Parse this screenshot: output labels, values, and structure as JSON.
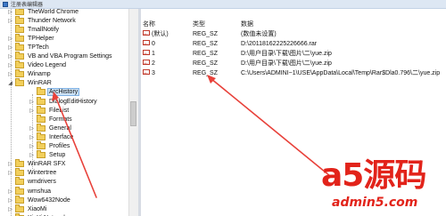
{
  "window": {
    "title": "注册表编辑器"
  },
  "tree": {
    "items": [
      {
        "label": "TheWorld Chrome",
        "depth": 0,
        "expander": "▷"
      },
      {
        "label": "Thunder Network",
        "depth": 0,
        "expander": "▷"
      },
      {
        "label": "TmallNotify",
        "depth": 0,
        "expander": ""
      },
      {
        "label": "TPHelper",
        "depth": 0,
        "expander": "▷"
      },
      {
        "label": "TPTech",
        "depth": 0,
        "expander": "▷"
      },
      {
        "label": "VB and VBA Program Settings",
        "depth": 0,
        "expander": "▷"
      },
      {
        "label": "Video Legend",
        "depth": 0,
        "expander": "▷"
      },
      {
        "label": "Winamp",
        "depth": 0,
        "expander": "▷"
      },
      {
        "label": "WinRAR",
        "depth": 0,
        "expander": "◢"
      },
      {
        "label": "ArcHistory",
        "depth": 1,
        "expander": "",
        "selected": true
      },
      {
        "label": "DialogEditHistory",
        "depth": 1,
        "expander": "▷"
      },
      {
        "label": "FileList",
        "depth": 1,
        "expander": "▷"
      },
      {
        "label": "Formats",
        "depth": 1,
        "expander": ""
      },
      {
        "label": "General",
        "depth": 1,
        "expander": "▷"
      },
      {
        "label": "Interface",
        "depth": 1,
        "expander": "▷"
      },
      {
        "label": "Profiles",
        "depth": 1,
        "expander": "▷"
      },
      {
        "label": "Setup",
        "depth": 1,
        "expander": "▷"
      },
      {
        "label": "WinRAR SFX",
        "depth": 0,
        "expander": "▷"
      },
      {
        "label": "Wintertree",
        "depth": 0,
        "expander": "▷"
      },
      {
        "label": "wmdrivers",
        "depth": 0,
        "expander": ""
      },
      {
        "label": "wmshua",
        "depth": 0,
        "expander": "▷"
      },
      {
        "label": "Wow6432Node",
        "depth": 0,
        "expander": "▷"
      },
      {
        "label": "XiaoMi",
        "depth": 0,
        "expander": "▷"
      },
      {
        "label": "XinYi Network",
        "depth": 0,
        "expander": "▷"
      }
    ]
  },
  "values": {
    "headers": {
      "name": "名称",
      "type": "类型",
      "data": "数据"
    },
    "rows": [
      {
        "name": "(默认)",
        "type": "REG_SZ",
        "data": "(数值未设置)"
      },
      {
        "name": "0",
        "type": "REG_SZ",
        "data": "D:\\20118162225226666.rar"
      },
      {
        "name": "1",
        "type": "REG_SZ",
        "data": "D:\\用户目录\\下载\\图片\\二\\yue.zip"
      },
      {
        "name": "2",
        "type": "REG_SZ",
        "data": "D:\\用户目录\\下载\\图片\\二\\yue.zip"
      },
      {
        "name": "3",
        "type": "REG_SZ",
        "data": "C:\\Users\\ADMINI~1\\USE\\AppData\\Local\\Temp\\Rar$Dla0.796\\二\\yue.zip"
      }
    ]
  },
  "watermark": {
    "brand": "a5源码",
    "site": "admin5.com"
  },
  "colors": {
    "annotation_arrow": "#e8413a",
    "selection": "#cde3f7",
    "folder": "#f2cf5c",
    "watermark": "#e2231a"
  }
}
